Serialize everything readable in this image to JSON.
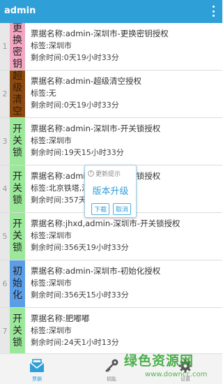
{
  "header": {
    "title": "admin",
    "menu_icon": "more-vert-icon"
  },
  "rows": [
    {
      "index": "1",
      "badge_chars": [
        "更",
        "换",
        "密",
        "钥"
      ],
      "badge_color": "#f2a6c2",
      "name": "票据名称:admin-深圳市-更换密钥授权",
      "tag": "标签:深圳市",
      "remain": "剩余时间:0天19小时33分"
    },
    {
      "index": "2",
      "badge_chars": [
        "超",
        "级",
        "清",
        "空"
      ],
      "badge_color": "#8b4a12",
      "name": "票据名称:admin-超级清空授权",
      "tag": "标签:无",
      "remain": "剩余时间:0天19小时33分"
    },
    {
      "index": "3",
      "badge_chars": [
        "开",
        "关",
        "锁"
      ],
      "badge_color": "#9be89b",
      "name": "票据名称:admin-深圳市-开关锁授权",
      "tag": "标签:深圳市",
      "remain": "剩余时间:19天15小时33分"
    },
    {
      "index": "4",
      "badge_chars": [
        "开",
        "关",
        "锁"
      ],
      "badge_color": "#9be89b",
      "name": "票据名称:admin-深圳市-开关锁授权",
      "tag": "标签:北京铁塔,深圳市",
      "remain": "剩余时间:357天21小时33分"
    },
    {
      "index": "5",
      "badge_chars": [
        "开",
        "关",
        "锁"
      ],
      "badge_color": "#9be89b",
      "name": "票据名称:jhxd,admin-深圳市-开关锁授权",
      "tag": "标签:深圳市",
      "remain": "剩余时间:356天19小时33分"
    },
    {
      "index": "6",
      "badge_chars": [
        "初",
        "始",
        "化"
      ],
      "badge_color": "#5a9ee8",
      "name": "票据名称:admin-深圳市-初始化授权",
      "tag": "标签:深圳市",
      "remain": "剩余时间:356天15小时33分"
    },
    {
      "index": "7",
      "badge_chars": [
        "开",
        "关",
        "锁"
      ],
      "badge_color": "#9be89b",
      "name": "票据名称:肥嘟嘟",
      "tag": "标签:深圳市",
      "remain": "剩余时间:24天1小时13分"
    }
  ],
  "dialog": {
    "title": "更新提示",
    "message": "版本升级",
    "ok_label": "下载",
    "cancel_label": "取消"
  },
  "tabs": [
    {
      "label": "票据",
      "icon": "ticket-envelope-icon",
      "active": true
    },
    {
      "label": "钥匙",
      "icon": "key-icon",
      "active": false
    },
    {
      "label": "设置",
      "icon": "gear-icon",
      "active": false
    }
  ],
  "watermark": {
    "line1": "绿色资源网",
    "line2": "www.downcc.com"
  },
  "colors": {
    "accent": "#2f9fd8",
    "watermark": "#3ba83a"
  }
}
